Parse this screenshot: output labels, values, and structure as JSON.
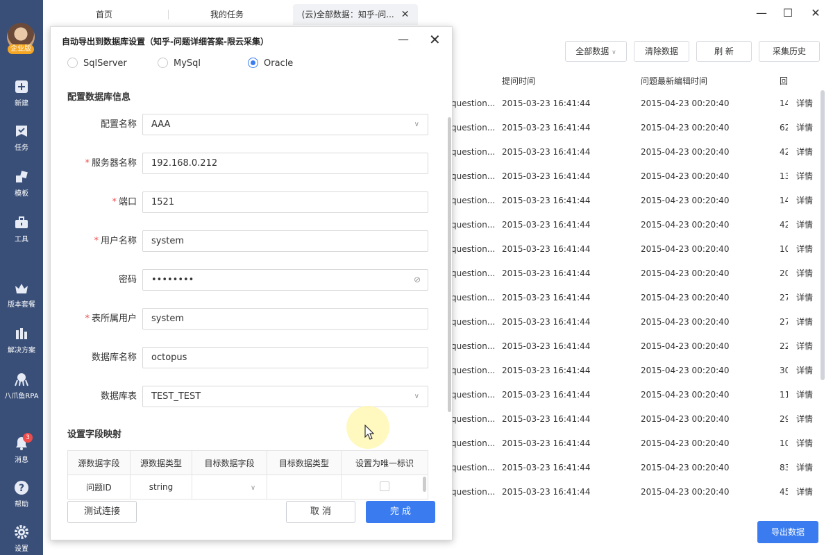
{
  "sidebar": {
    "badge": "企业版",
    "items": [
      {
        "label": "新建",
        "icon": "plus-icon"
      },
      {
        "label": "任务",
        "icon": "task-icon"
      },
      {
        "label": "模板",
        "icon": "template-icon"
      },
      {
        "label": "工具",
        "icon": "toolbox-icon"
      },
      {
        "label": "版本套餐",
        "icon": "crown-icon"
      },
      {
        "label": "解决方案",
        "icon": "solution-icon"
      },
      {
        "label": "八爪鱼RPA",
        "icon": "rpa-icon"
      },
      {
        "label": "消息",
        "icon": "bell-icon",
        "badge": "3"
      },
      {
        "label": "帮助",
        "icon": "help-icon"
      },
      {
        "label": "设置",
        "icon": "gear-icon"
      }
    ]
  },
  "tabs": [
    {
      "label": "首页"
    },
    {
      "label": "我的任务"
    },
    {
      "label": "(云)全部数据：知乎-问..."
    }
  ],
  "toolbar": {
    "filter": "全部数据",
    "clear": "清除数据",
    "refresh": "刷 新",
    "history": "采集历史",
    "export": "导出数据"
  },
  "table": {
    "headers": [
      "提问时间",
      "问题最新编辑时间",
      "回"
    ],
    "rows": [
      {
        "q": "question...",
        "t1": "2015-03-23 16:41:44",
        "t2": "2015-04-23 00:20:40",
        "n": "14",
        "a": "详情"
      },
      {
        "q": "question...",
        "t1": "2015-03-23 16:41:44",
        "t2": "2015-04-23 00:20:40",
        "n": "62",
        "a": "详情"
      },
      {
        "q": "question...",
        "t1": "2015-03-23 16:41:44",
        "t2": "2015-04-23 00:20:40",
        "n": "42",
        "a": "详情"
      },
      {
        "q": "question...",
        "t1": "2015-03-23 16:41:44",
        "t2": "2015-04-23 00:20:40",
        "n": "13",
        "a": "详情"
      },
      {
        "q": "question...",
        "t1": "2015-03-23 16:41:44",
        "t2": "2015-04-23 00:20:40",
        "n": "14",
        "a": "详情"
      },
      {
        "q": "question...",
        "t1": "2015-03-23 16:41:44",
        "t2": "2015-04-23 00:20:40",
        "n": "42",
        "a": "详情"
      },
      {
        "q": "question...",
        "t1": "2015-03-23 16:41:44",
        "t2": "2015-04-23 00:20:40",
        "n": "10",
        "a": "详情"
      },
      {
        "q": "question...",
        "t1": "2015-03-23 16:41:44",
        "t2": "2015-04-23 00:20:40",
        "n": "20",
        "a": "详情"
      },
      {
        "q": "question...",
        "t1": "2015-03-23 16:41:44",
        "t2": "2015-04-23 00:20:40",
        "n": "27",
        "a": "详情"
      },
      {
        "q": "question...",
        "t1": "2015-03-23 16:41:44",
        "t2": "2015-04-23 00:20:40",
        "n": "27",
        "a": "详情"
      },
      {
        "q": "question...",
        "t1": "2015-03-23 16:41:44",
        "t2": "2015-04-23 00:20:40",
        "n": "22",
        "a": "详情"
      },
      {
        "q": "question...",
        "t1": "2015-03-23 16:41:44",
        "t2": "2015-04-23 00:20:40",
        "n": "30",
        "a": "详情"
      },
      {
        "q": "question...",
        "t1": "2015-03-23 16:41:44",
        "t2": "2015-04-23 00:20:40",
        "n": "11",
        "a": "详情"
      },
      {
        "q": "question...",
        "t1": "2015-03-23 16:41:44",
        "t2": "2015-04-23 00:20:40",
        "n": "29",
        "a": "详情"
      },
      {
        "q": "question...",
        "t1": "2015-03-23 16:41:44",
        "t2": "2015-04-23 00:20:40",
        "n": "10",
        "a": "详情"
      },
      {
        "q": "question...",
        "t1": "2015-03-23 16:41:44",
        "t2": "2015-04-23 00:20:40",
        "n": "83",
        "a": "详情"
      },
      {
        "q": "question...",
        "t1": "2015-03-23 16:41:44",
        "t2": "2015-04-23 00:20:40",
        "n": "45",
        "a": "详情"
      }
    ]
  },
  "dialog": {
    "title": "自动导出到数据库设置（知乎-问题详细答案-限云采集）",
    "db_types": [
      {
        "label": "SqlServer",
        "selected": false
      },
      {
        "label": "MySql",
        "selected": false
      },
      {
        "label": "Oracle",
        "selected": true
      }
    ],
    "section_db": "配置数据库信息",
    "fields": {
      "config_name": {
        "label": "配置名称",
        "value": "AAA"
      },
      "server": {
        "label": "服务器名称",
        "value": "192.168.0.212"
      },
      "port": {
        "label": "端口",
        "value": "1521"
      },
      "user": {
        "label": "用户名称",
        "value": "system"
      },
      "password": {
        "label": "密码",
        "value": "••••••••"
      },
      "owner": {
        "label": "表所属用户",
        "value": "system"
      },
      "database": {
        "label": "数据库名称",
        "value": "octopus"
      },
      "table": {
        "label": "数据库表",
        "value": "TEST_TEST"
      }
    },
    "section_map": "设置字段映射",
    "map_headers": [
      "源数据字段",
      "源数据类型",
      "目标数据字段",
      "目标数据类型",
      "设置为唯一标识"
    ],
    "map_rows": [
      {
        "src_field": "问题ID",
        "src_type": "string",
        "dst_field": "",
        "dst_type": ""
      }
    ],
    "buttons": {
      "test": "测试连接",
      "cancel": "取 消",
      "done": "完 成"
    }
  },
  "colors": {
    "primary": "#3a7cf0",
    "sidebar": "#3a4f78",
    "required": "#f04b4b"
  }
}
